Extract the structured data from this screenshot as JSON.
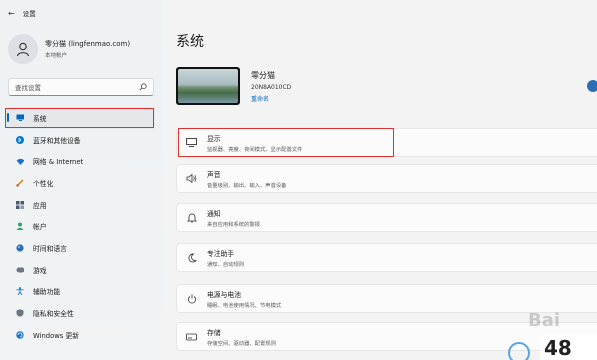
{
  "titlebar": {
    "title": "设置"
  },
  "profile": {
    "name": "零分猫 (lingfenmao.com)",
    "account_type": "本地帐户"
  },
  "search": {
    "placeholder": "查找设置"
  },
  "sidebar": {
    "items": [
      {
        "label": "系统",
        "icon": "display-icon",
        "color": "#0067c0",
        "active": true
      },
      {
        "label": "蓝牙和其他设备",
        "icon": "bluetooth-icon",
        "color": "#0078d4"
      },
      {
        "label": "网络 & Internet",
        "icon": "wifi-icon",
        "color": "#1a73c8"
      },
      {
        "label": "个性化",
        "icon": "brush-icon",
        "color": "#e08b2a"
      },
      {
        "label": "应用",
        "icon": "apps-icon",
        "color": "#4a5a6a"
      },
      {
        "label": "帐户",
        "icon": "person-icon",
        "color": "#2fa36b"
      },
      {
        "label": "时间和语言",
        "icon": "globe-icon",
        "color": "#2a6fb5"
      },
      {
        "label": "游戏",
        "icon": "gamepad-icon",
        "color": "#6b7680"
      },
      {
        "label": "辅助功能",
        "icon": "accessibility-icon",
        "color": "#1a73c8"
      },
      {
        "label": "隐私和安全性",
        "icon": "shield-icon",
        "color": "#6b7680"
      },
      {
        "label": "Windows 更新",
        "icon": "update-icon",
        "color": "#1a73c8"
      }
    ]
  },
  "main": {
    "title": "系统",
    "device": {
      "name": "零分猫",
      "model": "20N8A010CD",
      "rename": "重命名"
    },
    "cards": [
      {
        "title": "显示",
        "subtitle": "监视器、亮度、夜间模式、显示配置文件",
        "icon": "monitor-icon"
      },
      {
        "title": "声音",
        "subtitle": "音量级别、输出、输入、声音设备",
        "icon": "speaker-icon"
      },
      {
        "title": "通知",
        "subtitle": "来自应用和系统的警报",
        "icon": "bell-icon"
      },
      {
        "title": "专注助手",
        "subtitle": "通知、自动规则",
        "icon": "moon-icon"
      },
      {
        "title": "电源与电池",
        "subtitle": "睡眠、电池使用情况、节电模式",
        "icon": "power-icon"
      },
      {
        "title": "存储",
        "subtitle": "存储空间、驱动器、配置规则",
        "icon": "storage-icon"
      }
    ]
  },
  "watermark": {
    "text": "Bai",
    "number": "48"
  }
}
